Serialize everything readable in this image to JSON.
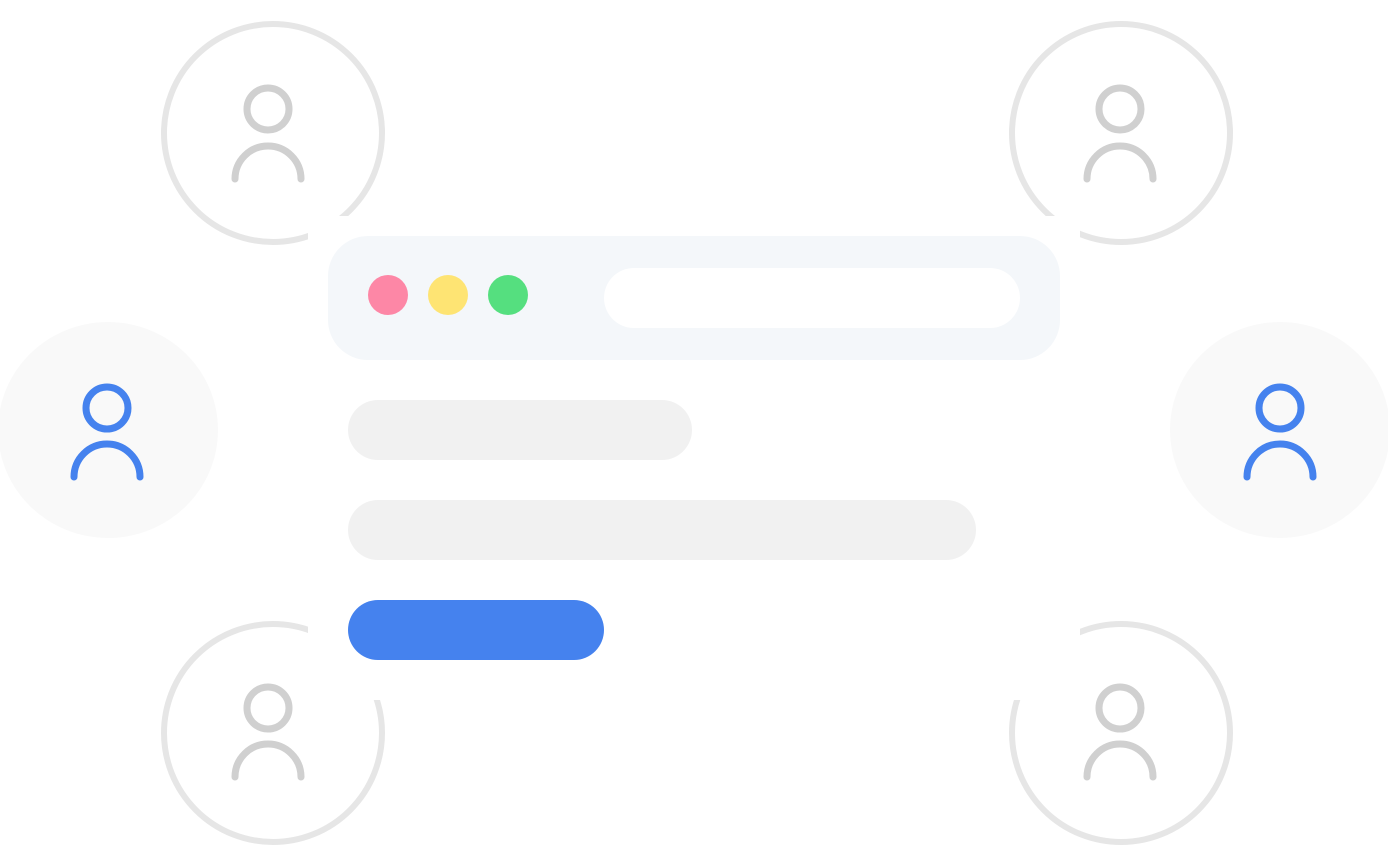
{
  "illustration": {
    "user_avatars": [
      {
        "id": "top-left",
        "icon": "user-icon"
      },
      {
        "id": "top-right",
        "icon": "user-icon"
      },
      {
        "id": "bottom-left",
        "icon": "user-icon"
      },
      {
        "id": "bottom-right",
        "icon": "user-icon"
      }
    ],
    "side_users": [
      {
        "id": "left",
        "icon": "user-icon"
      },
      {
        "id": "right",
        "icon": "user-icon"
      }
    ]
  },
  "window": {
    "controls": [
      {
        "name": "close",
        "color": "#fd87a6"
      },
      {
        "name": "minimize",
        "color": "#fee473"
      },
      {
        "name": "maximize",
        "color": "#55df7f"
      }
    ],
    "address_bar": {
      "value": "",
      "placeholder": ""
    }
  },
  "content": {
    "lines": [
      "",
      ""
    ],
    "primary_button_label": ""
  },
  "colors": {
    "accent": "#4582ee",
    "avatar_stroke": "#d0d0d0",
    "ring": "#e6e6e6",
    "window_bar": "#f4f7fa",
    "placeholder_line": "#f1f1f1"
  }
}
